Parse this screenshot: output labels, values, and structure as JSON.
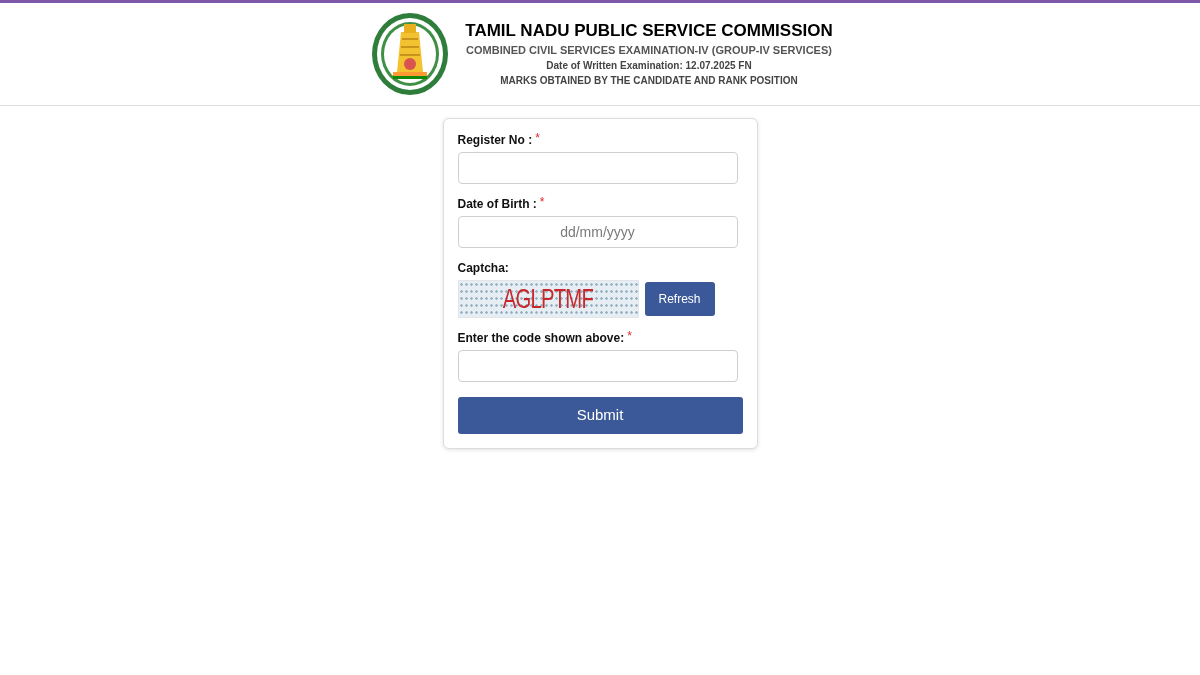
{
  "header": {
    "title": "TAMIL NADU PUBLIC SERVICE COMMISSION",
    "subtitle": "COMBINED CIVIL SERVICES EXAMINATION-IV (GROUP-IV SERVICES)",
    "exam_date": "Date of Written Examination: 12.07.2025 FN",
    "caption": "MARKS OBTAINED BY THE CANDIDATE AND RANK POSITION"
  },
  "form": {
    "fields": [
      {
        "kind": "text",
        "label": "Register No :",
        "required_mark": "*"
      },
      {
        "kind": "date",
        "label": "Date of Birth :",
        "required_mark": "*",
        "placeholder": "dd/mm/yyyy"
      },
      {
        "kind": "captcha",
        "label": "Captcha:",
        "code": "AGLPTMF",
        "button": "Refresh"
      },
      {
        "kind": "text",
        "label": "Enter the code shown above:",
        "required_mark": "*"
      }
    ],
    "submit": "Submit"
  }
}
